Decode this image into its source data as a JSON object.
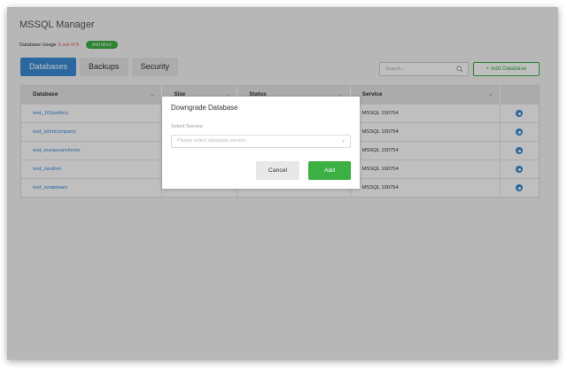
{
  "app": {
    "title": "MSSQL Manager"
  },
  "usage": {
    "label": "Database Usage",
    "count": "5 out of 5",
    "add_more": "Add More"
  },
  "tabs": [
    {
      "label": "Databases",
      "active": true
    },
    {
      "label": "Backups",
      "active": false
    },
    {
      "label": "Security",
      "active": false
    }
  ],
  "search": {
    "placeholder": "Search..."
  },
  "add_database": {
    "label": "+ Add Database"
  },
  "table": {
    "headers": [
      "Database",
      "Size",
      "Status",
      "Service"
    ],
    "rows": [
      {
        "database": "test_101politics",
        "service": "MSSQL 100754"
      },
      {
        "database": "test_tshirtcompany",
        "service": "MSSQL 100754"
      },
      {
        "database": "test_europeanclients",
        "service": "MSSQL 100754"
      },
      {
        "database": "test_random",
        "service": "MSSQL 100754"
      },
      {
        "database": "test_swapteam",
        "service": "MSSQL 100754"
      }
    ]
  },
  "modal": {
    "title": "Downgrade Database",
    "field_label": "Select Service",
    "select_placeholder": "Please select database service",
    "cancel_label": "Cancel",
    "add_label": "Add"
  },
  "colors": {
    "primary": "#3a8bd6",
    "success": "#3cb043",
    "danger": "#d9534f"
  },
  "icons": [
    "search-icon",
    "gear-icon",
    "chevron-down-icon",
    "plus-icon"
  ]
}
